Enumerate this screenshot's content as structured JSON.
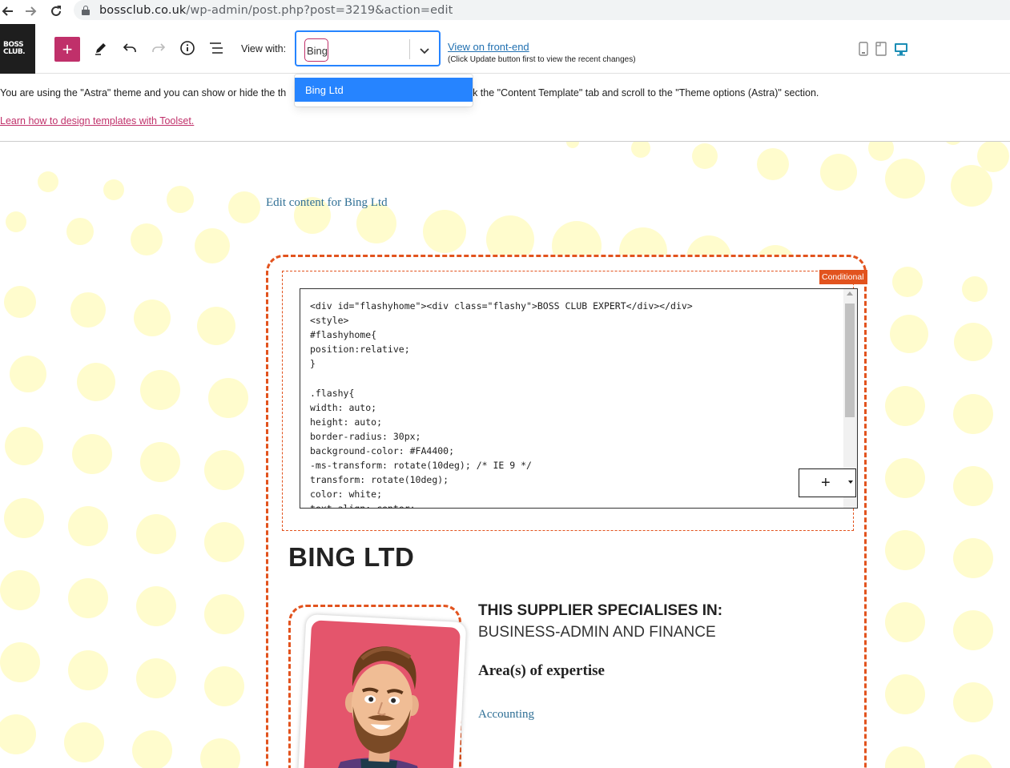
{
  "browser": {
    "url_host": "bossclub.co.uk",
    "url_path": "/wp-admin/post.php?post=3219&action=edit"
  },
  "toolbar": {
    "logo_line1": "BOSS",
    "logo_line2": "CLUB.",
    "inserter_label": "+",
    "view_with_label": "View with:",
    "select_value": "Bing",
    "frontend_link": "View on front-end",
    "frontend_note": "(Click Update button first to view the recent changes)",
    "icons": [
      "pencil-icon",
      "undo-icon",
      "redo-icon",
      "info-icon",
      "list-view-icon",
      "mobile-icon",
      "tablet-icon",
      "desktop-icon"
    ]
  },
  "dropdown": {
    "options": [
      "Bing Ltd"
    ]
  },
  "notice": {
    "text_before": "You are using the \"Astra\" theme and you can show or hide the th",
    "text_after": "lick the \"Content Template\" tab and scroll to the \"Theme options (Astra)\" section.",
    "learn_link": "Learn how to design templates with Toolset."
  },
  "canvas": {
    "edit_content": "Edit content for Bing Ltd",
    "badge": "Conditional",
    "code_lines": [
      "<div id=\"flashyhome\"><div class=\"flashy\">BOSS CLUB EXPERT</div></div>",
      "<style>",
      "#flashyhome{",
      "position:relative;",
      "}",
      "",
      ".flashy{",
      "width: auto;",
      "height: auto;",
      "border-radius: 30px;",
      "background-color: #FA4400;",
      "-ms-transform: rotate(10deg); /* IE 9 */",
      "transform: rotate(10deg);",
      "color: white;",
      "text-align: center;"
    ],
    "add_block": "+",
    "business_title": "BING LTD",
    "spec_title": "THIS SUPPLIER SPECIALISES IN:",
    "spec_value": "BUSINESS-ADMIN AND FINANCE",
    "expertise_title": "Area(s) of expertise",
    "expertise_link": "Accounting"
  },
  "colors": {
    "accent": "#c0306a",
    "select_focus": "#2684ff",
    "conditional": "#e2531e",
    "link": "#2271b1",
    "dots": "#fffccd"
  }
}
